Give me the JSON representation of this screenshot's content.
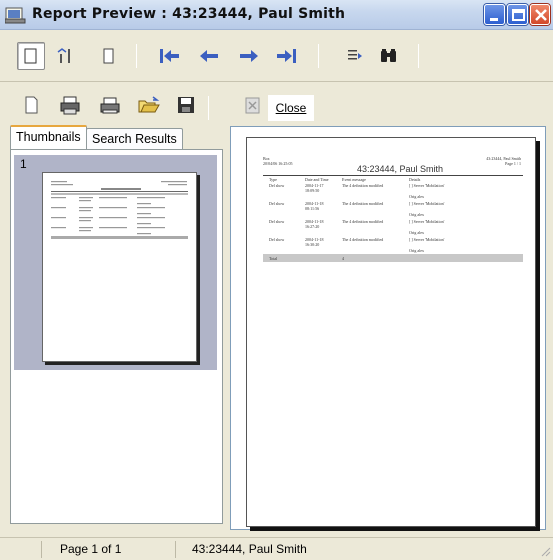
{
  "window": {
    "title": "Report Preview : 43:23444, Paul Smith"
  },
  "toolbar": {
    "row1_icons": [
      "single-page-icon",
      "page-break-icon",
      "page-width-icon",
      "first-page-icon",
      "previous-page-icon",
      "next-page-icon",
      "last-page-icon",
      "goto-page-icon",
      "find-icon"
    ],
    "row2_icons": [
      "new-document-icon",
      "print-setup-icon",
      "print-icon",
      "open-icon",
      "save-icon",
      "disabled-export-icon"
    ],
    "close_label": "Close"
  },
  "tabs": [
    {
      "label": "Thumbnails",
      "active": true
    },
    {
      "label": "Search Results",
      "active": false
    }
  ],
  "thumbnail": {
    "page_number": "1"
  },
  "report": {
    "header_left_1": "Box",
    "header_left_2": "20/04/06 16:25:05",
    "header_right_1": "43:23444, Paul Smith",
    "header_right_2": "Page 1 / 1",
    "title": "43:23444, Paul Smith",
    "columns": [
      "Type",
      "Date and Time",
      "Event message",
      "Details"
    ],
    "rows": [
      {
        "type": "Del show",
        "datetime": "2004-11-17 18:09:50",
        "message": "The 4 definition modified",
        "detail": "[ ] Server 'Mobilation'",
        "note": "Orig alex"
      },
      {
        "type": "Del show",
        "datetime": "2004-11-18 08:11:56",
        "message": "The 4 definition modified",
        "detail": "[ ] Server 'Mobilation'",
        "note": "Orig alex"
      },
      {
        "type": "Del show",
        "datetime": "2004-11-18 16:27:20",
        "message": "The 4 definition modified",
        "detail": "[ ] Server 'Mobilation'",
        "note": "Orig alex"
      },
      {
        "type": "Del show",
        "datetime": "2004-11-18 16:30:20",
        "message": "The 4 definition modified",
        "detail": "[ ] Server 'Mobilation'",
        "note": "Orig alex"
      }
    ],
    "total_label": "Total",
    "total_value": "4"
  },
  "status": {
    "page_info": "Page 1 of 1",
    "record_name": "43:23444, Paul Smith"
  },
  "colors": {
    "title_gradient_top": "#d9e5f4",
    "nav_arrow_blue": "#3b5fc0",
    "tab_active_accent": "#e7a73f",
    "thumbnail_selection": "#b0b4c8"
  }
}
